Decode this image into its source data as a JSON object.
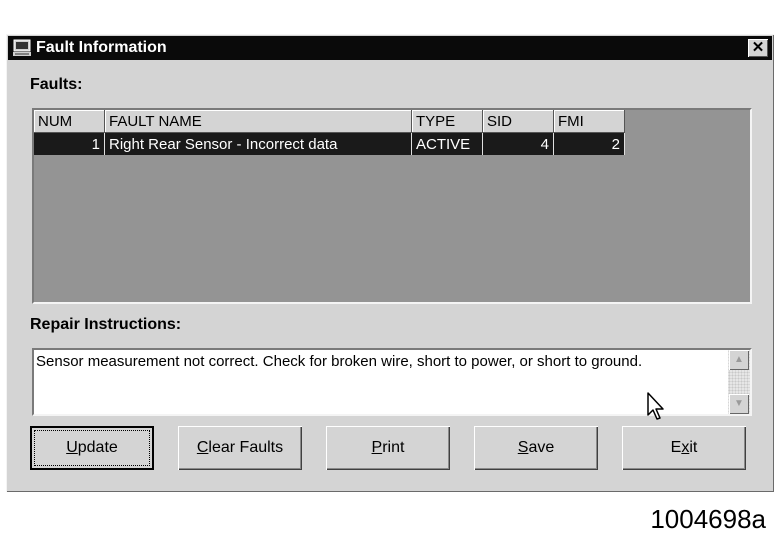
{
  "window": {
    "title": "Fault Information",
    "close_label": "✕"
  },
  "faults": {
    "label": "Faults:",
    "columns": [
      "NUM",
      "FAULT NAME",
      "TYPE",
      "SID",
      "FMI"
    ],
    "rows": [
      {
        "num": "1",
        "name": "Right Rear Sensor - Incorrect data",
        "type": "ACTIVE",
        "sid": "4",
        "fmi": "2"
      }
    ]
  },
  "repair": {
    "label": "Repair Instructions:",
    "text": "Sensor measurement not correct.  Check for broken wire, short to power, or short to ground."
  },
  "buttons": {
    "update": {
      "first": "U",
      "rest": "pdate"
    },
    "clear": {
      "first": "C",
      "rest": "lear Faults"
    },
    "print": {
      "first": "P",
      "rest": "rint"
    },
    "save": {
      "first": "S",
      "rest": "ave"
    },
    "exit": {
      "before": "E",
      "u": "x",
      "after": "it"
    }
  },
  "figure_id": "1004698a"
}
